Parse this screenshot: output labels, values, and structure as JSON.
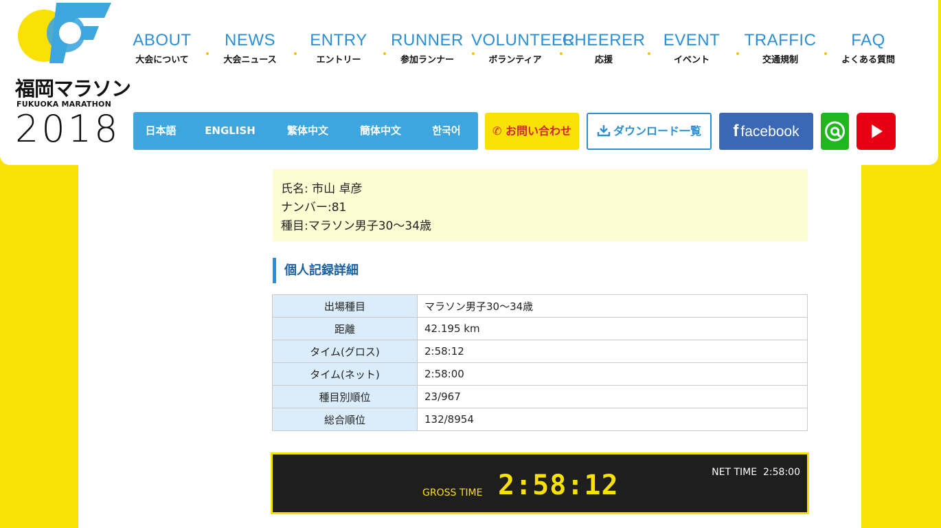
{
  "logo": {
    "name_jp": "福岡マラソン",
    "name_en": "FUKUOKA MARATHON",
    "year": "2018"
  },
  "nav": [
    {
      "en": "ABOUT",
      "jp": "大会について"
    },
    {
      "en": "NEWS",
      "jp": "大会ニュース"
    },
    {
      "en": "ENTRY",
      "jp": "エントリー"
    },
    {
      "en": "RUNNER",
      "jp": "参加ランナー"
    },
    {
      "en": "VOLUNTEER",
      "jp": "ボランティア"
    },
    {
      "en": "CHEERER",
      "jp": "応援"
    },
    {
      "en": "EVENT",
      "jp": "イベント"
    },
    {
      "en": "TRAFFIC",
      "jp": "交通規制"
    },
    {
      "en": "FAQ",
      "jp": "よくある質問"
    }
  ],
  "languages": [
    "日本語",
    "ENGLISH",
    "繁体中文",
    "簡体中文",
    "한국어"
  ],
  "buttons": {
    "contact": "お問い合わせ",
    "download": "ダウンロード一覧",
    "facebook": "facebook"
  },
  "runner": {
    "name": "氏名: 市山 卓彦",
    "number": "ナンバー:81",
    "category": "種目:マラソン男子30～34歳"
  },
  "section_title": "個人記録詳細",
  "details": [
    {
      "label": "出場種目",
      "value": "マラソン男子30～34歳"
    },
    {
      "label": "距離",
      "value": "42.195 km"
    },
    {
      "label": "タイム(グロス)",
      "value": "2:58:12"
    },
    {
      "label": "タイム(ネット)",
      "value": "2:58:00"
    },
    {
      "label": "種目別順位",
      "value": "23/967"
    },
    {
      "label": "総合順位",
      "value": "132/8954"
    }
  ],
  "board": {
    "gross_label": "GROSS TIME",
    "gross_value": "2:58:12",
    "net_label": "NET TIME",
    "net_value": "2:58:00"
  },
  "colors": {
    "brand_yellow": "#f9e006",
    "brand_blue": "#2a8fd4"
  }
}
